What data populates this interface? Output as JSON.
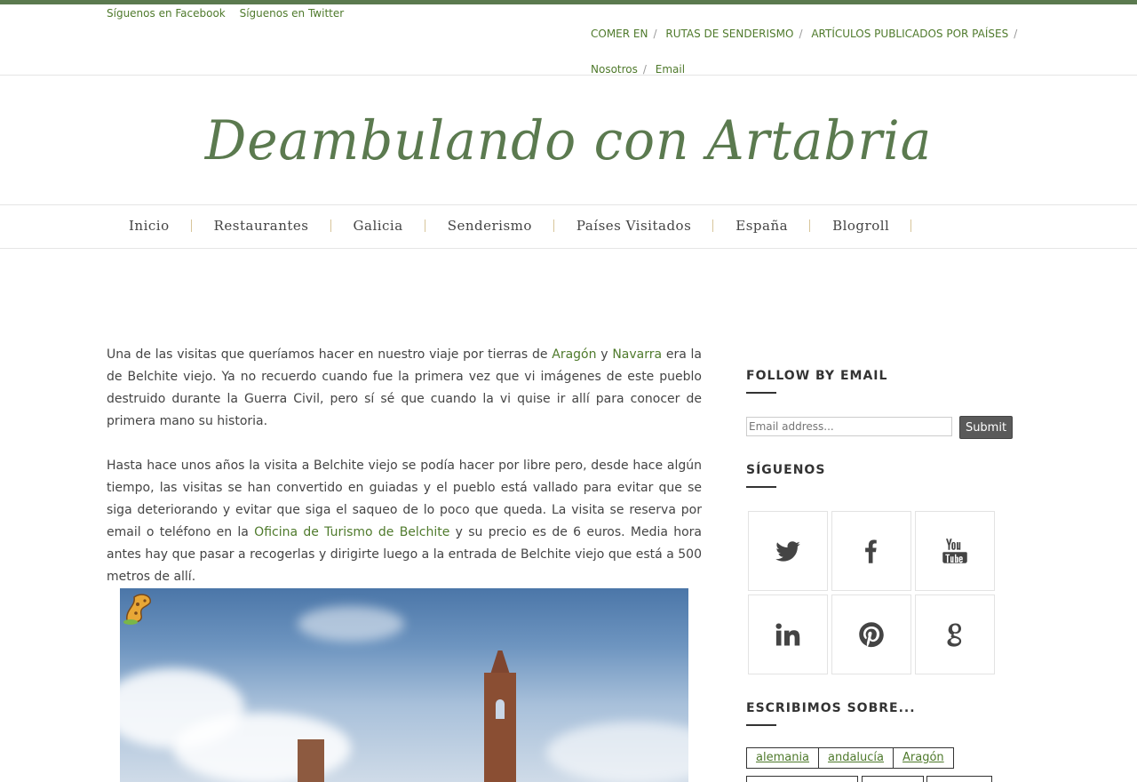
{
  "topbar": {
    "social": [
      "Síguenos en Facebook",
      "Síguenos en Twitter"
    ],
    "nav_row1": [
      "COMER EN",
      "RUTAS DE SENDERISMO",
      "ARTÍCULOS PUBLICADOS POR PAÍSES"
    ],
    "nav_row2": [
      "Nosotros",
      "Email"
    ],
    "separator": "/"
  },
  "site": {
    "title": "Deambulando con Artabria"
  },
  "main_nav": [
    "Inicio",
    "Restaurantes",
    "Galicia",
    "Senderismo",
    "Países Visitados",
    "España",
    "Blogroll"
  ],
  "article": {
    "p1_before": "Una de las visitas que queríamos hacer en nuestro viaje por tierras de ",
    "p1_link1": "Aragón",
    "p1_mid": " y ",
    "p1_link2": "Navarra",
    "p1_after": " era la de Belchite viejo. Ya no recuerdo cuando fue la primera vez que vi imágenes de este pueblo destruido durante la Guerra Civil, pero sí sé que cuando la vi quise ir allí para conocer de primera mano su historia.",
    "p2_before": "Hasta hace unos años la visita a Belchite viejo se podía hacer por libre pero, desde hace algún tiempo, las visitas se han convertido en guiadas y el pueblo está vallado para evitar que se siga deteriorando y evitar que siga el saqueo de lo poco que queda. La visita se reserva por email o teléfono en la ",
    "p2_link": "Oficina de Turismo de Belchite",
    "p2_after": " y su precio es de 6 euros. Media hora antes hay que pasar a recogerlas y dirigirte luego a la entrada de Belchite viejo que está a 500 metros de allí."
  },
  "sidebar": {
    "follow_title": "FOLLOW BY EMAIL",
    "email_placeholder": "Email address...",
    "submit_label": "Submit",
    "siguenos_title": "SÍGUENOS",
    "social_icons": [
      "twitter-icon",
      "facebook-icon",
      "youtube-icon",
      "linkedin-icon",
      "pinterest-icon",
      "google-icon"
    ],
    "escribimos_title": "ESCRIBIMOS SOBRE...",
    "tags": [
      "alemania",
      "andalucía",
      "Aragón"
    ]
  },
  "colors": {
    "accent": "#4f7a2c",
    "title_green": "#5b7a4f"
  }
}
